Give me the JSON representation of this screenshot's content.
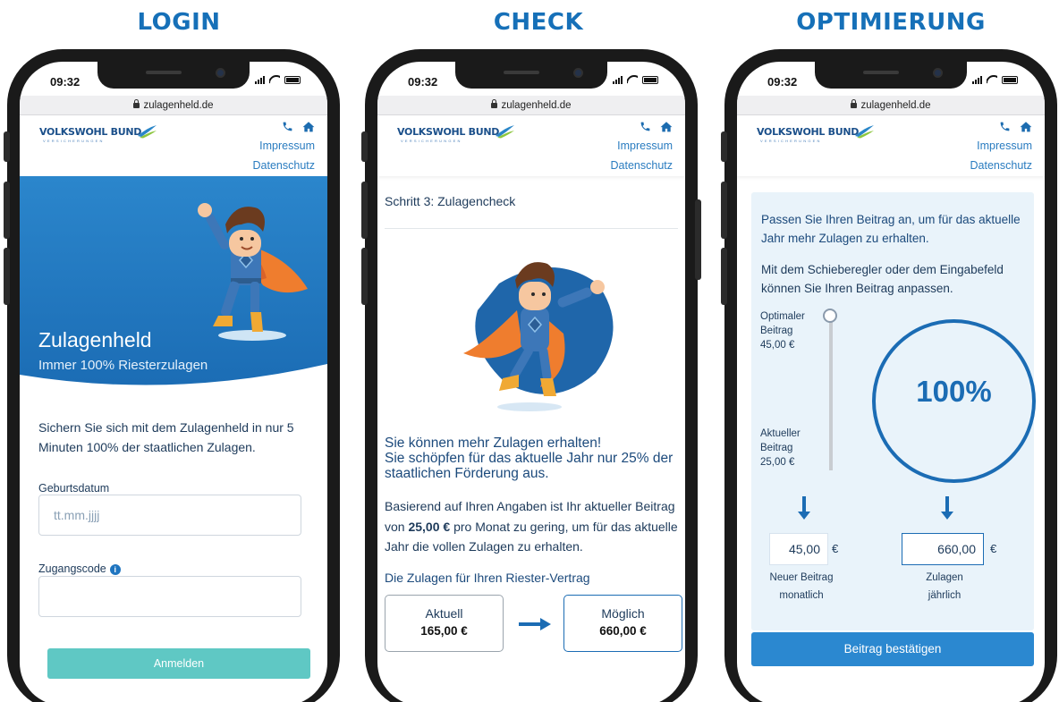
{
  "sections": [
    {
      "title": "LOGIN"
    },
    {
      "title": "CHECK"
    },
    {
      "title": "OPTIMIERUNG"
    }
  ],
  "status": {
    "time": "09:32"
  },
  "browser": {
    "url": "zulagenheld.de"
  },
  "header": {
    "logo_text": "VOLKSWOHL BUND",
    "logo_sub": "VERSICHERUNGEN",
    "impressum": "Impressum",
    "datenschutz": "Datenschutz",
    "phone_icon": "phone-icon",
    "home_icon": "home-icon"
  },
  "login": {
    "hero_title": "Zulagenheld",
    "hero_subtitle": "Immer 100% Riesterzulagen",
    "intro": "Sichern Sie sich mit dem Zulagenheld in nur 5 Minuten 100% der staatlichen Zulagen.",
    "dob_label": "Geburtsdatum",
    "dob_placeholder": "tt.mm.jjjj",
    "code_label": "Zugangscode",
    "code_value": "",
    "submit": "Anmelden",
    "colors": {
      "hero": "#1b6cb4",
      "button": "#5fc8c4"
    }
  },
  "check": {
    "step": "Schritt 3: Zulagencheck",
    "result_heading_1": "Sie können mehr Zulagen erhalten!",
    "result_heading_2": "Sie schöpfen für das aktuelle Jahr nur 25% der staatlichen Förderung aus.",
    "body_1": "Basierend auf Ihren Angaben ist Ihr aktueller Beitrag von",
    "body_amount": "25,00 €",
    "body_2": "pro Monat zu gering, um für das aktuelle Jahr die vollen Zulagen zu erhalten.",
    "subheading": "Die Zulagen für Ihren Riester-Vertrag",
    "current_label": "Aktuell",
    "current_value": "165,00 €",
    "possible_label": "Möglich",
    "possible_value": "660,00 €"
  },
  "optimize": {
    "heading": "Passen Sie Ihren Beitrag an, um für das aktuelle Jahr mehr Zulagen zu erhalten.",
    "instruction": "Mit dem Schieberegler oder dem Eingabefeld können Sie Ihren Beitrag anpassen.",
    "optimal_label_1": "Optimaler",
    "optimal_label_2": "Beitrag",
    "optimal_value": "45,00 €",
    "current_label_1": "Aktueller",
    "current_label_2": "Beitrag",
    "current_value": "25,00 €",
    "percent": "100%",
    "new_contribution": "45,00",
    "allowance": "660,00",
    "currency": "€",
    "new_label_1": "Neuer Beitrag",
    "new_label_2": "monatlich",
    "allow_label_1": "Zulagen",
    "allow_label_2": "jährlich",
    "confirm": "Beitrag bestätigen",
    "colors": {
      "primary": "#2b88d0",
      "panel": "#e9f3fa"
    }
  }
}
